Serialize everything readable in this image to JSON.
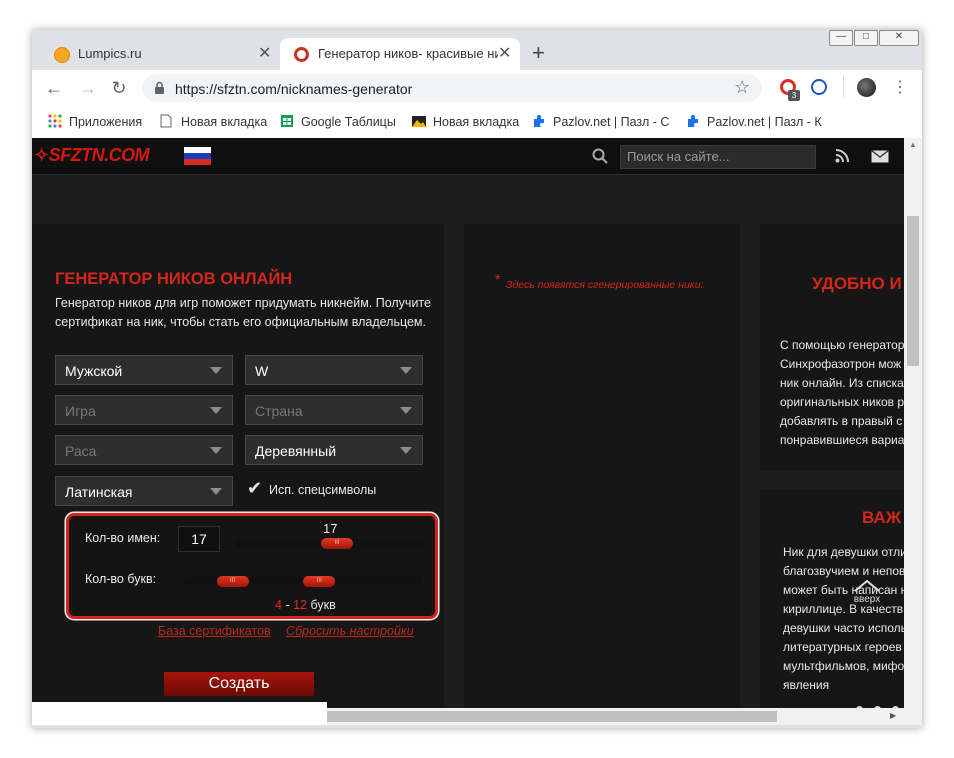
{
  "browser": {
    "window_controls": [
      "—",
      "□",
      "✕"
    ],
    "tabs": [
      {
        "label": "Lumpics.ru",
        "active": false
      },
      {
        "label": "Генератор ников- красивые ни",
        "active": true
      }
    ],
    "new_tab": "+",
    "url": "https://sfztn.com/nicknames-generator",
    "extension_badge": "3",
    "bookmarks": [
      {
        "label": "Приложения",
        "icon": "apps-grid-icon"
      },
      {
        "label": "Новая вкладка",
        "icon": "page-icon"
      },
      {
        "label": "Google Таблицы",
        "icon": "sheets-icon"
      },
      {
        "label": "Новая вкладка",
        "icon": "image-icon"
      },
      {
        "label": "Pazlov.net | Пазл - С",
        "icon": "puzzle-icon"
      },
      {
        "label": "Pazlov.net | Пазл - К",
        "icon": "puzzle-icon"
      }
    ]
  },
  "site": {
    "logo": "SFZTN.COM",
    "search_placeholder": "Поиск на сайте..."
  },
  "generator": {
    "title": "ГЕНЕРАТОР НИКОВ ОНЛАЙН",
    "description_line1": "Генератор ников для игр поможет придумать никнейм. Получите",
    "description_line2": "сертификат на ник, чтобы стать его официальным владельцем.",
    "gender": "Мужской",
    "letter": "W",
    "game_placeholder": "Игра",
    "country_placeholder": "Страна",
    "race_placeholder": "Раса",
    "style": "Деревянный",
    "alphabet": "Латинская",
    "special_chars_label": "Исп. спецсимволы",
    "special_chars_checked": true,
    "names_count_label": "Кол-во имен:",
    "names_count": "17",
    "names_count_value": 17,
    "names_count_range": [
      1,
      30
    ],
    "letters_label": "Кол-во букв:",
    "letters_min": "4",
    "letters_dash": "-",
    "letters_max": "12",
    "letters_unit": "букв",
    "letters_min_value": 4,
    "letters_max_value": 12,
    "letters_range": [
      1,
      20
    ],
    "handle_grip": "III",
    "certificates_link": "База сертификатов",
    "reset_link": "Сбросить настройки",
    "create_button": "Создать"
  },
  "results": {
    "asterisk": "*",
    "hint": "Здесь появятся сгенерированные ники:"
  },
  "right": {
    "title1": "УДОБНО И",
    "text1": [
      "С помощью генератор",
      "Синхрофазотрон мож",
      "ник онлайн. Из списка",
      "оригинальных ников р",
      "добавлять в правый с",
      "понравившиеся вариа"
    ],
    "title2": "ВАЖ",
    "text2": [
      "Ник для девушки отли",
      "благозвучием и непов",
      "может быть написан н",
      "кириллице. В качеств",
      "девушки часто исполь",
      "литературных героев",
      "мультфильмов, мифо",
      "явления"
    ],
    "up_label": "вверх"
  },
  "colors": {
    "accent_red": "#d3261a",
    "page_bg": "#1d1d1d",
    "highlight_border": "#d8231a"
  }
}
